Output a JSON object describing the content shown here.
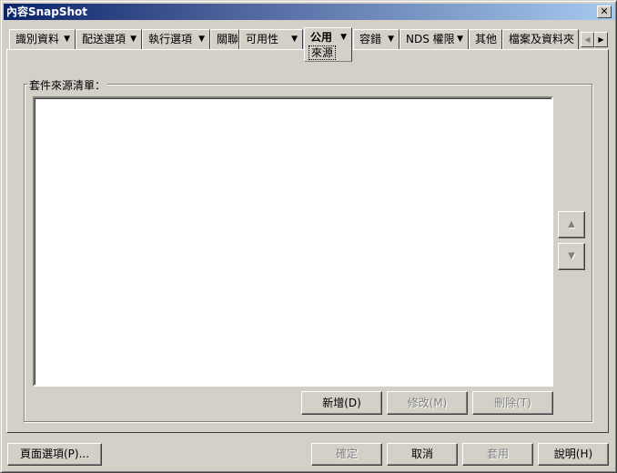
{
  "window": {
    "title": "內容SnapShot",
    "close": "✕"
  },
  "tabs": [
    {
      "label": "識別資料",
      "dropdown": true
    },
    {
      "label": "配送選項",
      "dropdown": true
    },
    {
      "label": "執行選項",
      "dropdown": true
    },
    {
      "label": "關聯",
      "dropdown": false
    },
    {
      "label": "可用性",
      "dropdown": true
    },
    {
      "label": "公用",
      "dropdown": true,
      "active": true,
      "subtab": "來源"
    },
    {
      "label": "容錯",
      "dropdown": true
    },
    {
      "label": "NDS 權限",
      "dropdown": true
    },
    {
      "label": "其他",
      "dropdown": false
    },
    {
      "label": "檔案及資料夾",
      "dropdown": false
    }
  ],
  "dropdown_glyph": "▼",
  "scroll": {
    "left": "◀",
    "right": "▶"
  },
  "group": {
    "label": "套件來源清單：",
    "items": []
  },
  "list_buttons": {
    "up": "▲",
    "down": "▼",
    "add": "新增(D)",
    "modify": "修改(M)",
    "delete": "刪除(T)"
  },
  "footer": {
    "page_options": "頁面選項(P)...",
    "ok": "確定",
    "cancel": "取消",
    "apply": "套用",
    "help": "說明(H)"
  }
}
